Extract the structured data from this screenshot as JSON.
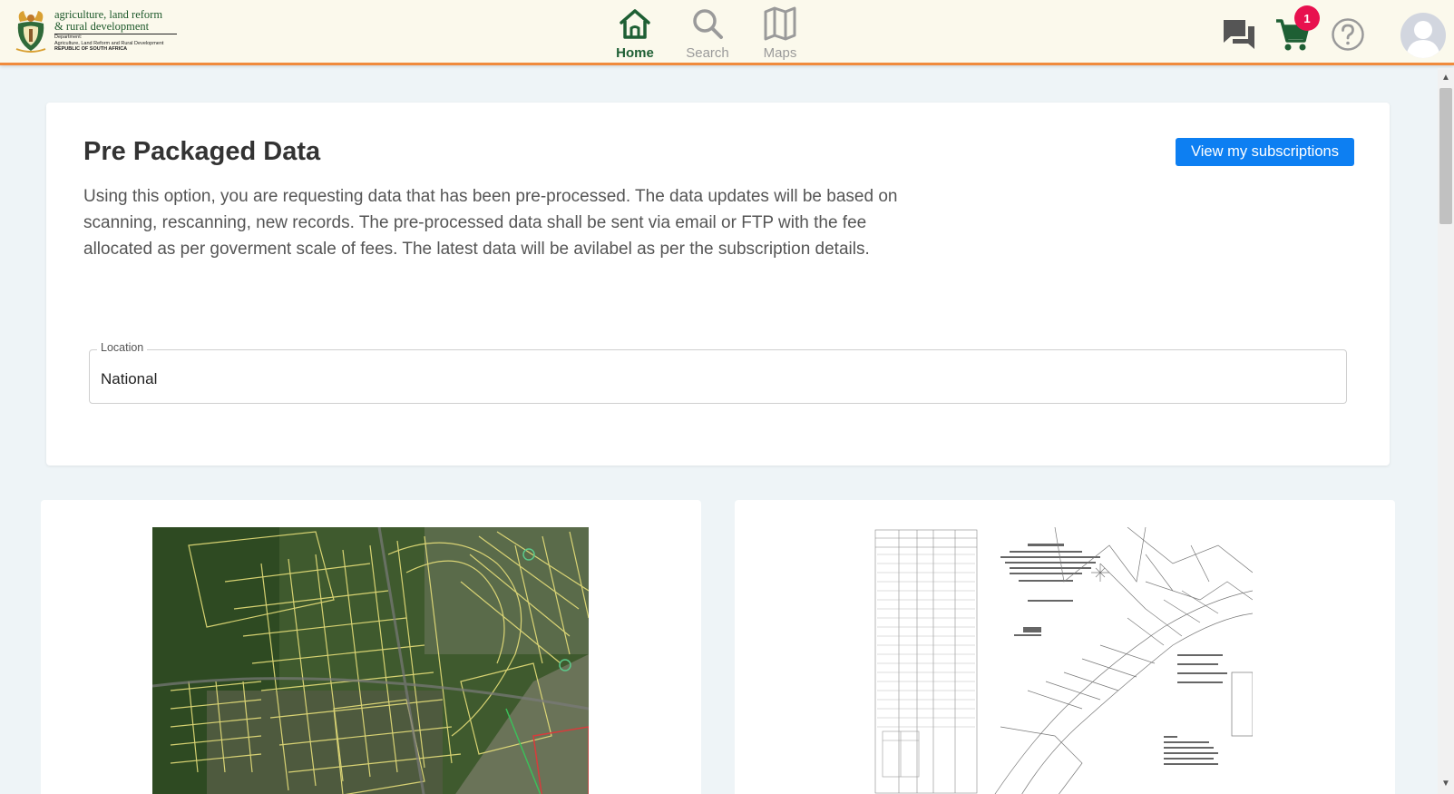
{
  "header": {
    "logo": {
      "line1": "agriculture, land reform",
      "line2": "& rural development",
      "line3": "Department:",
      "line4": "Agriculture, Land Reform and Rural Development",
      "line5": "REPUBLIC OF SOUTH AFRICA"
    },
    "nav": [
      {
        "label": "Home",
        "icon": "home-icon",
        "active": true
      },
      {
        "label": "Search",
        "icon": "search-icon",
        "active": false
      },
      {
        "label": "Maps",
        "icon": "map-icon",
        "active": false
      }
    ],
    "cart_count": "1",
    "icons": [
      "chat-icon",
      "cart-icon",
      "help-icon",
      "avatar"
    ]
  },
  "main": {
    "title": "Pre Packaged Data",
    "subscriptions_button": "View my subscriptions",
    "description": "Using this option, you are requesting data that has been pre-processed. The data updates will be based on scanning, rescanning, new records. The pre-processed data shall be sent via email or FTP with the fee allocated as per goverment scale of fees. The latest data will be avilabel as per the subscription details.",
    "location": {
      "label": "Location",
      "value": "National"
    }
  },
  "products": [
    {
      "image": "aerial-cadastral-map"
    },
    {
      "image": "general-plan-diagram"
    }
  ],
  "colors": {
    "accent_green": "#1e5f34",
    "header_bg": "#fbf9ec",
    "header_border": "#f08a3c",
    "button_blue": "#0d7ff2",
    "badge_red": "#e8114f",
    "page_bg": "#eef4f7"
  }
}
